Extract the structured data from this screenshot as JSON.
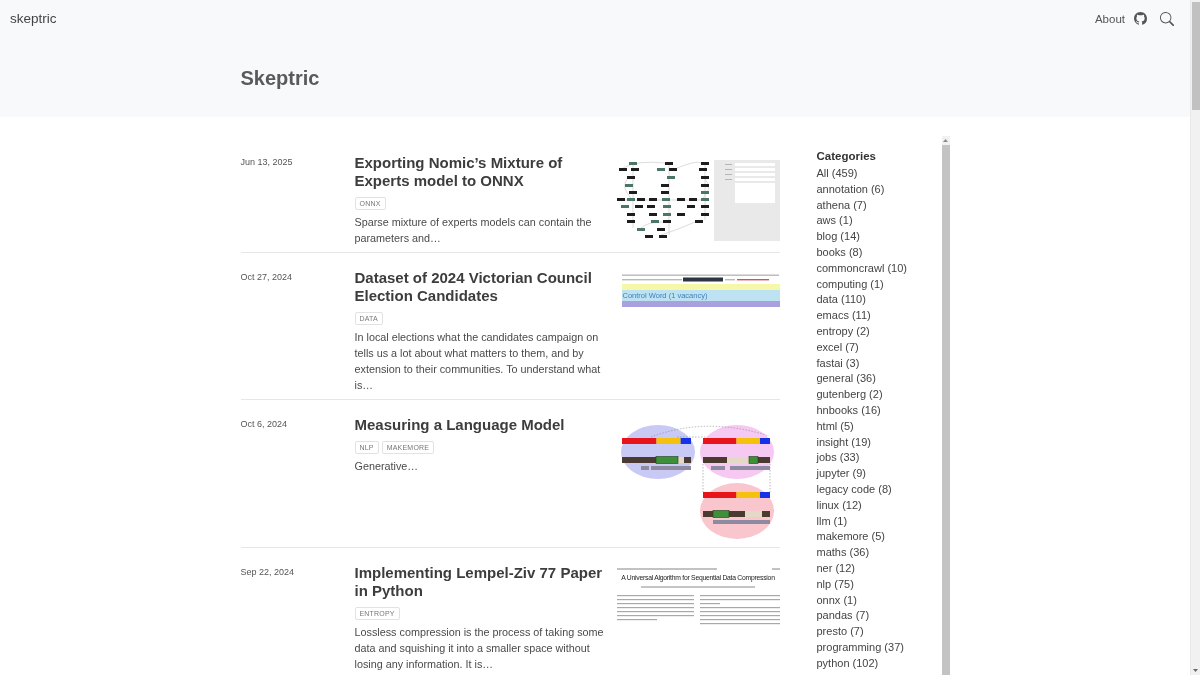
{
  "navbar": {
    "brand": "skeptric",
    "about_link": "About"
  },
  "header": {
    "title": "Skeptric"
  },
  "posts": [
    {
      "date": "Jun 13, 2025",
      "title": "Exporting Nomic’s Mixture of Experts model to ONNX",
      "tags": [
        "ONNX"
      ],
      "summary": "Sparse mixture of experts models can contain the parameters and…",
      "thumbnail": {
        "kind": "graph"
      }
    },
    {
      "date": "Oct 27, 2024",
      "title": "Dataset of 2024 Victorian Council Election Candidates",
      "tags": [
        "DATA"
      ],
      "summary": "In local elections what the candidates campaign on tells us a lot about what matters to them, and by extension to their communities. To understand what is…",
      "thumbnail": {
        "kind": "highlight",
        "caption": "Control Word (1 vacancy)"
      }
    },
    {
      "date": "Oct 6, 2024",
      "title": "Measuring a Language Model",
      "tags": [
        "NLP",
        "MAKEMORE"
      ],
      "summary": "Generative…",
      "thumbnail": {
        "kind": "bars"
      }
    },
    {
      "date": "Sep 22, 2024",
      "title": "Implementing Lempel-Ziv 77 Paper in Python",
      "tags": [
        "ENTROPY"
      ],
      "summary": "Lossless compression is the process of taking some data and squishing it into a smaller space without losing any information. It is…",
      "thumbnail": {
        "kind": "paper",
        "title": "A Universal Algorithm for Sequential Data Compression"
      }
    }
  ],
  "sidebar": {
    "heading": "Categories",
    "categories": [
      "All (459)",
      "annotation (6)",
      "athena (7)",
      "aws (1)",
      "blog (14)",
      "books (8)",
      "commoncrawl (10)",
      "computing (1)",
      "data (110)",
      "emacs (11)",
      "entropy (2)",
      "excel (7)",
      "fastai (3)",
      "general (36)",
      "gutenberg (2)",
      "hnbooks (16)",
      "html (5)",
      "insight (19)",
      "jobs (33)",
      "jupyter (9)",
      "legacy code (8)",
      "linux (12)",
      "llm (1)",
      "makemore (5)",
      "maths (36)",
      "ner (12)",
      "nlp (75)",
      "onnx (1)",
      "pandas (7)",
      "presto (7)",
      "programming (37)",
      "python (102)"
    ]
  }
}
